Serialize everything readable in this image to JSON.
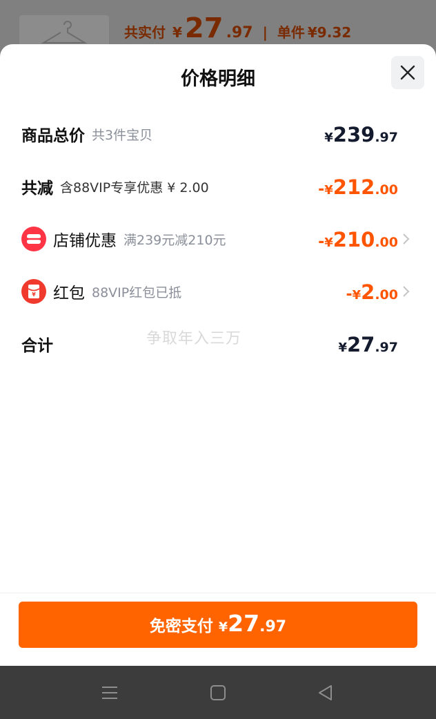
{
  "background": {
    "paid_label": "共实付",
    "paid_currency": "¥",
    "paid_int": "27",
    "paid_dec": ".97",
    "unit_label": "单件",
    "unit_price": "¥9.32"
  },
  "sheet": {
    "title": "价格明细",
    "close_icon": "close-icon"
  },
  "rows": {
    "total": {
      "title": "商品总价",
      "note": "共3件宝贝",
      "currency": "¥",
      "int": "239",
      "dec": ".97"
    },
    "discount": {
      "title": "共减",
      "note": "含88VIP专享优惠 ¥ 2.00",
      "sign": "-",
      "currency": "¥",
      "int": "212",
      "dec": ".00"
    },
    "shop": {
      "title": "店铺优惠",
      "note": "满239元减210元",
      "sign": "-",
      "currency": "¥",
      "int": "210",
      "dec": ".00",
      "icon": "shop-coupon-icon"
    },
    "redpacket": {
      "title": "红包",
      "note": "88VIP红包已抵",
      "sign": "-",
      "currency": "¥",
      "int": "2",
      "dec": ".00",
      "icon": "red-packet-icon"
    },
    "sum": {
      "title": "合计",
      "currency": "¥",
      "int": "27",
      "dec": ".97"
    }
  },
  "watermark": "争取年入三万",
  "pay_button": {
    "label": "免密支付",
    "currency": "¥",
    "int": "27",
    "dec": ".97"
  },
  "nav": {
    "menu_icon": "menu-icon",
    "home_icon": "home-square-icon",
    "back_icon": "back-triangle-icon"
  },
  "colors": {
    "accent": "#ff6400",
    "discount": "#ff5500",
    "text_dark": "#151b2e",
    "note_gray": "#8a8f99"
  }
}
